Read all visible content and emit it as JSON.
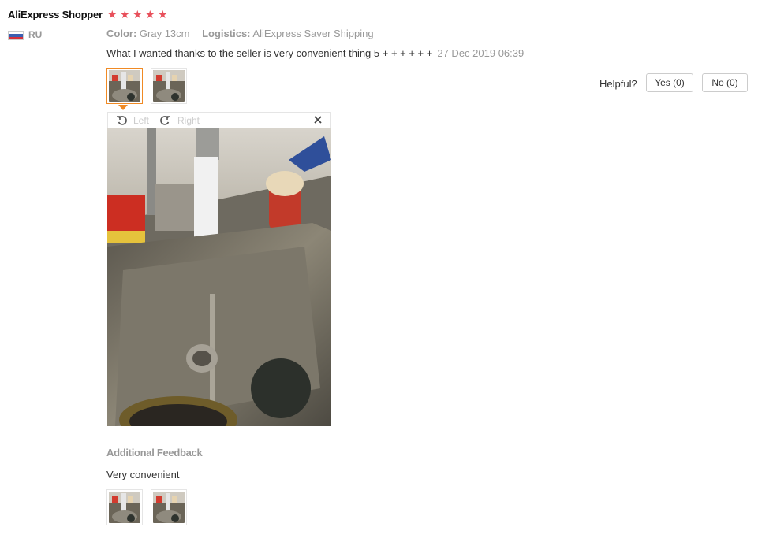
{
  "review": {
    "user_name": "AliExpress Shopper",
    "rating": 5,
    "country": "RU",
    "flag_colors": [
      "#ffffff",
      "#3b5fb0",
      "#d6303a"
    ],
    "color_label": "Color:",
    "color_value": "Gray 13cm",
    "logistics_label": "Logistics:",
    "logistics_value": "AliExpress Saver Shipping",
    "text": "What I wanted thanks to the seller is very convenient thing 5 + + + + + +",
    "date": "27 Dec 2019 06:39"
  },
  "viewer": {
    "rotate_left_label": "Left",
    "rotate_right_label": "Right",
    "close_icon": "close-icon"
  },
  "helpful": {
    "label": "Helpful?",
    "yes_label": "Yes (0)",
    "no_label": "No (0)"
  },
  "additional": {
    "title": "Additional Feedback",
    "text": "Very convenient"
  },
  "colors": {
    "star": "#e8505b",
    "accent": "#f08a24"
  }
}
